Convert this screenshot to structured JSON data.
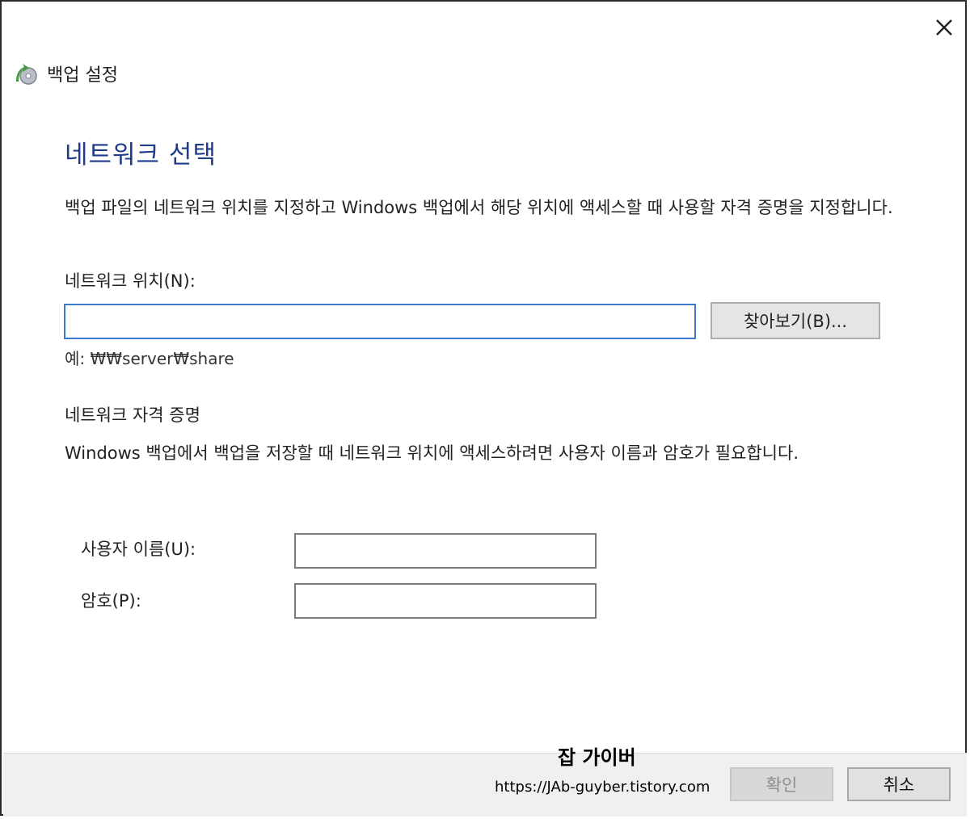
{
  "window": {
    "title": "백업 설정",
    "close_glyph": "✕"
  },
  "page": {
    "heading": "네트워크 선택",
    "description": "백업 파일의 네트워크 위치를 지정하고 Windows 백업에서 해당 위치에 액세스할 때 사용할 자격 증명을 지정합니다."
  },
  "network_location": {
    "label": "네트워크 위치(N):",
    "value": "",
    "browse_label": "찾아보기(B)...",
    "example": "예: ₩₩server₩share"
  },
  "credentials": {
    "heading": "네트워크 자격 증명",
    "description": "Windows 백업에서 백업을 저장할 때 네트워크 위치에 액세스하려면 사용자 이름과 암호가 필요합니다.",
    "username_label": "사용자 이름(U):",
    "username_value": "",
    "password_label": "암호(P):",
    "password_value": ""
  },
  "footer": {
    "watermark_title": "잡 가이버",
    "watermark_url": "https://JAb-guyber.tistory.com",
    "ok_label": "확인",
    "cancel_label": "취소",
    "ok_enabled": false
  },
  "colors": {
    "heading": "#1f3c8c",
    "input_focus_border": "#3a7bd0",
    "footer_bg": "#f0f0f0"
  },
  "icons": {
    "app": "backup-settings-icon",
    "close": "close-icon"
  }
}
